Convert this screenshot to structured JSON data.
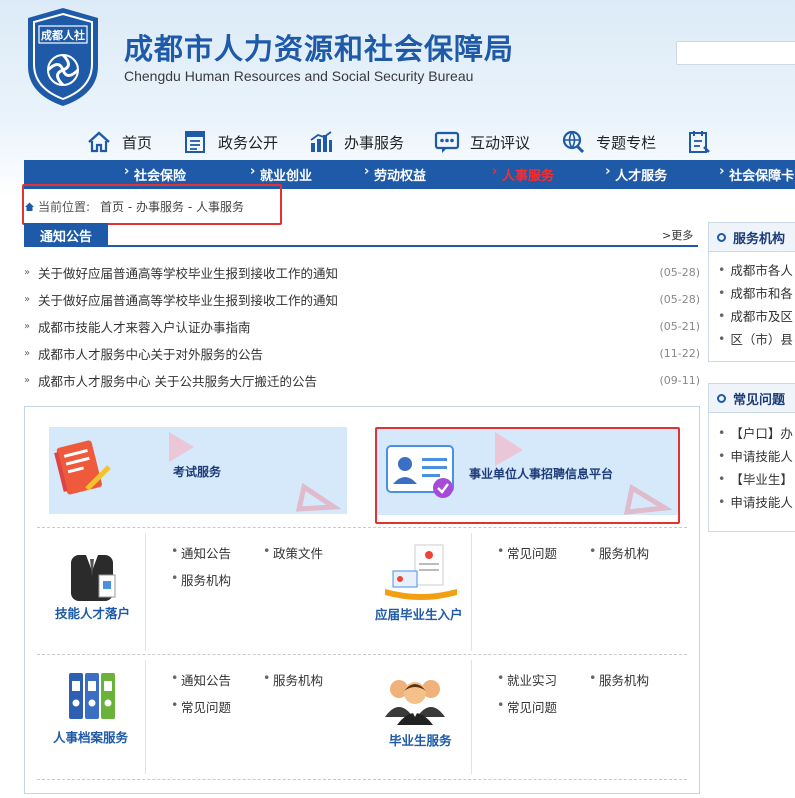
{
  "header": {
    "logo_text": "成都人社",
    "title": "成都市人力资源和社会保障局",
    "subtitle": "Chengdu Human Resources and Social Security Bureau"
  },
  "main_nav": [
    {
      "label": "首页",
      "icon": "home-icon"
    },
    {
      "label": "政务公开",
      "icon": "gov-doc-icon"
    },
    {
      "label": "办事服务",
      "icon": "bar-chart-icon"
    },
    {
      "label": "互动评议",
      "icon": "chat-bubble-icon"
    },
    {
      "label": "专题专栏",
      "icon": "globe-search-icon"
    },
    {
      "label": "",
      "icon": "calendar-icon"
    }
  ],
  "sub_nav": [
    {
      "label": "社会保险"
    },
    {
      "label": "就业创业"
    },
    {
      "label": "劳动权益"
    },
    {
      "label": "人事服务",
      "active": true
    },
    {
      "label": "人才服务"
    },
    {
      "label": "社会保障卡"
    }
  ],
  "breadcrumb": {
    "label": "当前位置:",
    "path": "首页 - 办事服务 - 人事服务"
  },
  "notice": {
    "title": "通知公告",
    "more": ">更多",
    "items": [
      {
        "title": "关于做好应届普通高等学校毕业生报到接收工作的通知",
        "date": "(05-28)"
      },
      {
        "title": "关于做好应届普通高等学校毕业生报到接收工作的通知",
        "date": "(05-28)"
      },
      {
        "title": "成都市技能人才来蓉入户认证办事指南",
        "date": "(05-21)"
      },
      {
        "title": "成都市人才服务中心关于对外服务的公告",
        "date": "(11-22)"
      },
      {
        "title": "成都市人才服务中心 关于公共服务大厅搬迁的公告",
        "date": "(09-11)"
      }
    ]
  },
  "banners": {
    "exam": "考试服务",
    "recruit": "事业单位人事招聘信息平台"
  },
  "services": {
    "skill": {
      "label": "技能人才落户",
      "links": [
        "通知公告",
        "政策文件",
        "服务机构"
      ]
    },
    "grad_hukou": {
      "label": "应届毕业生入户",
      "links": [
        "常见问题",
        "服务机构"
      ]
    },
    "archive": {
      "label": "人事档案服务",
      "links": [
        "通知公告",
        "服务机构",
        "常见问题"
      ]
    },
    "grad_service": {
      "label": "毕业生服务",
      "links": [
        "就业实习",
        "服务机构",
        "常见问题"
      ]
    }
  },
  "sidebar": {
    "agency": {
      "title": "服务机构",
      "items": [
        "成都市各人",
        "成都市和各",
        "成都市及区",
        "区（市）县"
      ]
    },
    "faq": {
      "title": "常见问题",
      "items": [
        "【户口】办",
        "申请技能人",
        "【毕业生】",
        "申请技能人"
      ]
    }
  },
  "colors": {
    "brand_blue": "#1e5aa8",
    "active_red": "#ff2b2b",
    "highlight_box": "#e23232"
  }
}
